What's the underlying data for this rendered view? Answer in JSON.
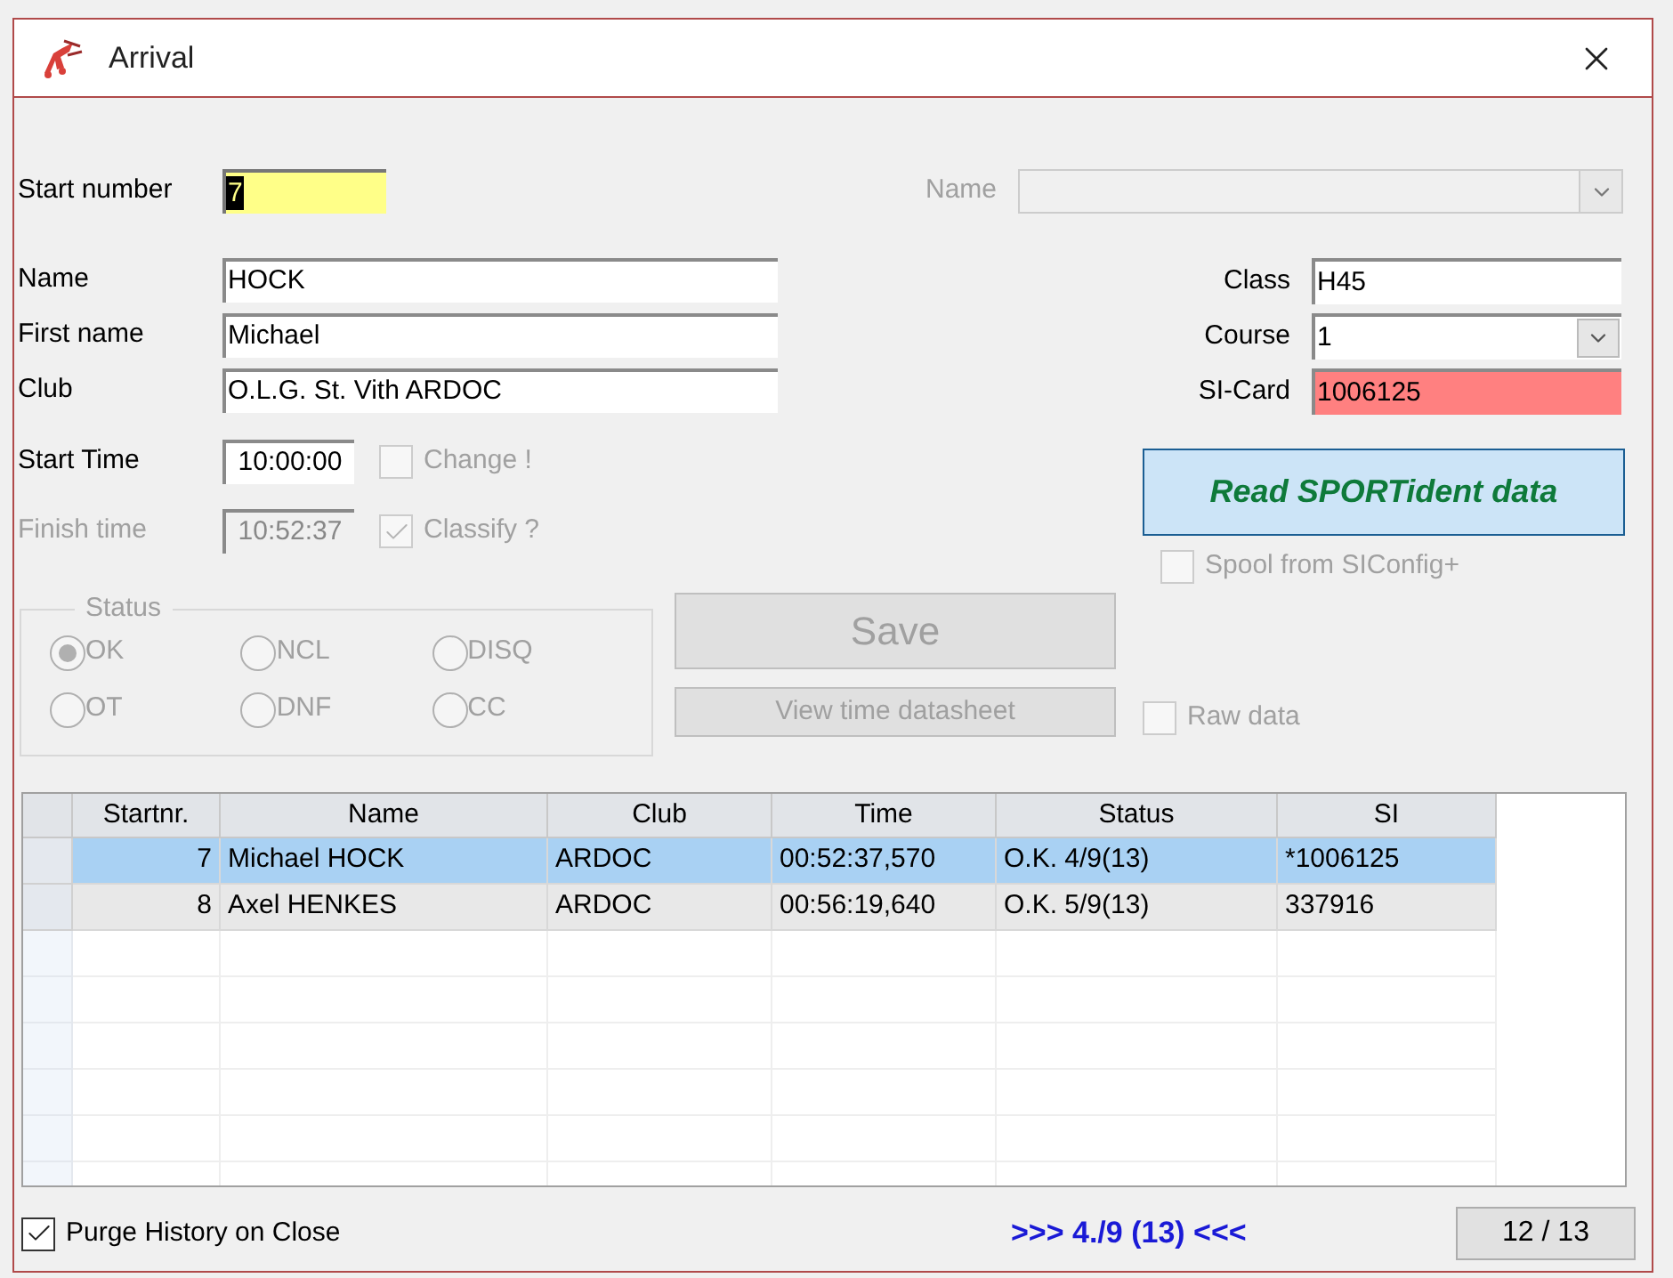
{
  "window": {
    "title": "Arrival"
  },
  "start_number": {
    "label": "Start number",
    "value": "7"
  },
  "name_lookup": {
    "label": "Name",
    "disabled": true
  },
  "person_fields": [
    {
      "label": "Name",
      "value": "HOCK"
    },
    {
      "label": "First name",
      "value": "Michael"
    },
    {
      "label": "Club",
      "value": "O.L.G. St. Vith ARDOC"
    }
  ],
  "race_fields": [
    {
      "label": "Class",
      "value": "H45",
      "kind": "text"
    },
    {
      "label": "Course",
      "value": "1",
      "kind": "dropdown"
    },
    {
      "label": "SI-Card",
      "value": "1006125",
      "kind": "alert"
    }
  ],
  "start_time": {
    "label": "Start Time",
    "value": "10:00:00",
    "disabled": false
  },
  "change_option": {
    "label": "Change !",
    "checked": false,
    "disabled": true
  },
  "finish_time": {
    "label": "Finish time",
    "value": "10:52:37",
    "disabled": true
  },
  "classify_option": {
    "label": "Classify ?",
    "checked": true,
    "disabled": true
  },
  "read_button": {
    "label": "Read SPORTident data"
  },
  "spool_option": {
    "label": "Spool from SIConfig+",
    "checked": false,
    "disabled": true
  },
  "status_group": {
    "title": "Status",
    "disabled": true,
    "options": [
      {
        "label": "OK",
        "selected": true
      },
      {
        "label": "NCL",
        "selected": false
      },
      {
        "label": "DISQ",
        "selected": false
      },
      {
        "label": "OT",
        "selected": false
      },
      {
        "label": "DNF",
        "selected": false
      },
      {
        "label": "CC",
        "selected": false
      }
    ]
  },
  "save_button": {
    "label": "Save",
    "disabled": true
  },
  "datasheet_button": {
    "label": "View time datasheet",
    "disabled": true
  },
  "raw_data_option": {
    "label": "Raw data",
    "checked": false,
    "disabled": true
  },
  "table": {
    "columns": [
      "Startnr.",
      "Name",
      "Club",
      "Time",
      "Status",
      "SI"
    ],
    "rows": [
      {
        "cells": [
          "7",
          "Michael HOCK",
          "ARDOC",
          "00:52:37,570",
          "O.K. 4/9(13)",
          "*1006125"
        ],
        "selected": true
      },
      {
        "cells": [
          "8",
          "Axel HENKES",
          "ARDOC",
          "00:56:19,640",
          "O.K. 5/9(13)",
          "337916"
        ],
        "selected": false
      }
    ]
  },
  "purge_option": {
    "label": "Purge History on Close",
    "checked": true,
    "disabled": false
  },
  "result_text": ">>> 4./9 (13) <<<",
  "counter_button": {
    "label": "12 / 13"
  }
}
